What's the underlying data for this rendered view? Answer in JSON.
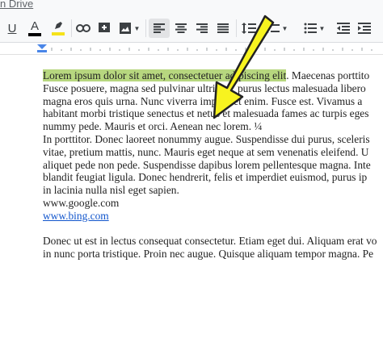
{
  "header": {
    "drive_label": "n Drive"
  },
  "toolbar": {
    "underline_label": "U",
    "text_color_label": "A",
    "highlight_color": "#f5e21a",
    "text_color": "#000000",
    "icons": [
      "underline-icon",
      "text-color-icon",
      "highlight-icon",
      "link-icon",
      "comment-icon",
      "image-icon",
      "align-left-icon",
      "align-center-icon",
      "align-right-icon",
      "justify-icon",
      "line-spacing-icon",
      "numbered-list-icon",
      "bulleted-list-icon"
    ]
  },
  "document": {
    "highlighted_text": "Lorem ipsum dolor sit amet, consectetuer adipiscing elit",
    "lines": [
      ". Maecenas porttito",
      "Fusce posuere, magna sed pulvinar ultricies, purus lectus malesuada libero",
      "magna eros quis urna. Nunc viverra imperdiet enim. Fusce est. Vivamus a",
      "habitant morbi tristique senectus et netus et malesuada fames ac turpis eges",
      "nummy pede. Mauris et orci. Aenean nec lorem. ¼",
      "In porttitor. Donec laoreet nonummy augue. Suspendisse dui purus, sceleris",
      "vitae, pretium mattis, nunc. Mauris eget neque at sem venenatis eleifend. U",
      "aliquet pede non pede. Suspendisse dapibus lorem pellentesque magna. Inte",
      "blandit feugiat ligula. Donec hendrerit, felis et imperdiet euismod, purus ip",
      "in lacinia nulla nisl eget sapien.",
      "www.google.com"
    ],
    "link_text": "www.bing.com",
    "lines_after": [
      "Donec ut est in lectus consequat consectetur. Etiam eget dui. Aliquam erat vo",
      "in nunc porta tristique. Proin nec augue. Quisque aliquam tempor magna. Pe"
    ]
  },
  "colors": {
    "accent_arrow": "#f7f31f",
    "highlight": "#b7d77f",
    "link": "#1155cc"
  }
}
